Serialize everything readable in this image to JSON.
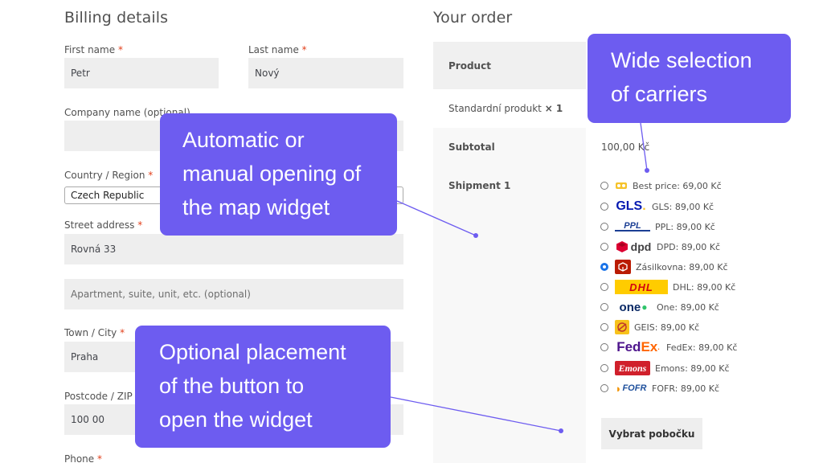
{
  "billing": {
    "heading": "Billing details",
    "first_name_label": "First name",
    "first_name_value": "Petr",
    "last_name_label": "Last name",
    "last_name_value": "Nový",
    "company_label": "Company name (optional)",
    "country_label": "Country / Region",
    "country_value": "Czech Republic",
    "street_label": "Street address",
    "street_value": "Rovná 33",
    "apartment_placeholder": "Apartment, suite, unit, etc. (optional)",
    "town_label": "Town / City",
    "town_value": "Praha",
    "postcode_label": "Postcode / ZIP",
    "postcode_value": "100 00",
    "phone_label": "Phone",
    "required_mark": "*"
  },
  "order": {
    "heading": "Your order",
    "product_header": "Product",
    "product_name": "Standardní produkt",
    "product_qty": "× 1",
    "subtotal_label": "Subtotal",
    "subtotal_value": "100,00 Kč",
    "shipment_label": "Shipment 1",
    "carriers": [
      {
        "logo": "best-price-logo",
        "label": "Best price: 69,00 Kč",
        "selected": false
      },
      {
        "logo": "gls-logo",
        "logo_text": "GLS",
        "label": "GLS: 89,00 Kč",
        "selected": false
      },
      {
        "logo": "ppl-logo",
        "logo_text": "PPL",
        "label": "PPL: 89,00 Kč",
        "selected": false
      },
      {
        "logo": "dpd-logo",
        "logo_text": "dpd",
        "label": "DPD: 89,00 Kč",
        "selected": false
      },
      {
        "logo": "zasilkovna-logo",
        "label": "Zásilkovna: 89,00 Kč",
        "selected": true
      },
      {
        "logo": "dhl-logo",
        "logo_text": "DHL",
        "label": "DHL: 89,00 Kč",
        "selected": false
      },
      {
        "logo": "one-logo",
        "logo_text": "one",
        "label": "One: 89,00 Kč",
        "selected": false
      },
      {
        "logo": "geis-logo",
        "label": "GEIS: 89,00 Kč",
        "selected": false
      },
      {
        "logo": "fedex-logo",
        "logo_text": "FedEx",
        "label": "FedEx: 89,00 Kč",
        "selected": false
      },
      {
        "logo": "emons-logo",
        "logo_text": "Emons",
        "label": "Emons: 89,00 Kč",
        "selected": false
      },
      {
        "logo": "fofr-logo",
        "logo_text": "FOFR",
        "label": "FOFR: 89,00 Kč",
        "selected": false
      }
    ],
    "select_branch_button": "Vybrat pobočku"
  },
  "callouts": {
    "carriers": [
      "Wide selection",
      "of carriers"
    ],
    "map_widget": [
      "Automatic or",
      "manual opening of",
      "the map widget"
    ],
    "button_placement": [
      "Optional placement",
      "of the button to",
      "open the widget"
    ]
  },
  "colors": {
    "callout_bg": "#6d5cf0",
    "radio_selected": "#1a73e8",
    "required": "#e2401c",
    "field_bg": "#eeeeee"
  }
}
